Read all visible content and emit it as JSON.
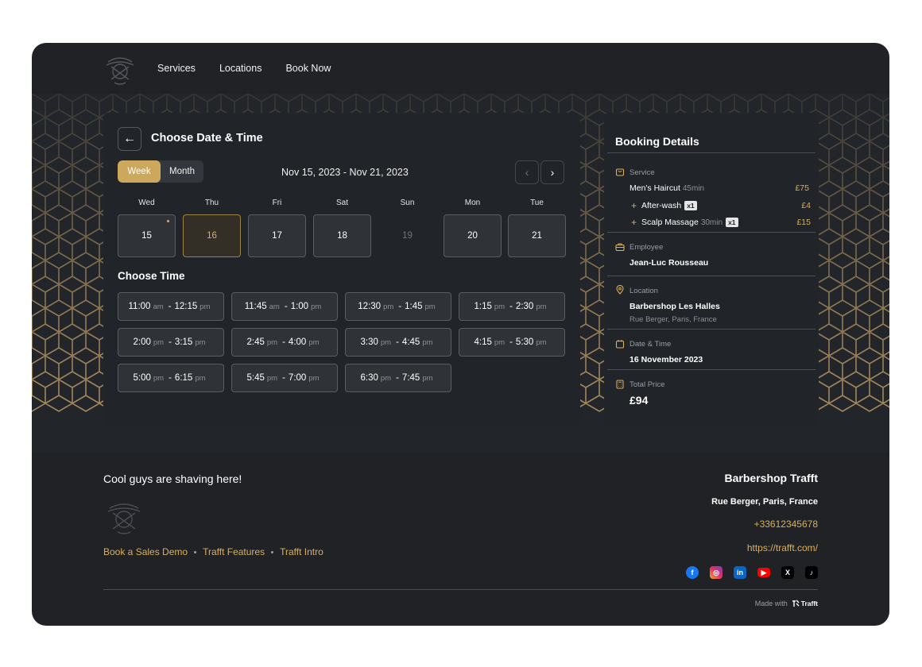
{
  "nav": {
    "items": [
      "Services",
      "Locations",
      "Book Now"
    ]
  },
  "calendar": {
    "title": "Choose Date & Time",
    "view_week": "Week",
    "view_month": "Month",
    "range": "Nov 15, 2023 - Nov 21, 2023",
    "days": [
      {
        "name": "Wed",
        "num": "15",
        "state": "available",
        "dot": true
      },
      {
        "name": "Thu",
        "num": "16",
        "state": "selected",
        "dot": false
      },
      {
        "name": "Fri",
        "num": "17",
        "state": "available",
        "dot": false
      },
      {
        "name": "Sat",
        "num": "18",
        "state": "available",
        "dot": false
      },
      {
        "name": "Sun",
        "num": "19",
        "state": "unavailable",
        "dot": false
      },
      {
        "name": "Mon",
        "num": "20",
        "state": "available",
        "dot": false
      },
      {
        "name": "Tue",
        "num": "21",
        "state": "available",
        "dot": false
      }
    ],
    "choose_time": "Choose Time",
    "slots": [
      {
        "start": "11:00",
        "start_ap": "am",
        "end": "12:15",
        "end_ap": "pm"
      },
      {
        "start": "11:45",
        "start_ap": "am",
        "end": "1:00",
        "end_ap": "pm"
      },
      {
        "start": "12:30",
        "start_ap": "pm",
        "end": "1:45",
        "end_ap": "pm"
      },
      {
        "start": "1:15",
        "start_ap": "pm",
        "end": "2:30",
        "end_ap": "pm"
      },
      {
        "start": "2:00",
        "start_ap": "pm",
        "end": "3:15",
        "end_ap": "pm"
      },
      {
        "start": "2:45",
        "start_ap": "pm",
        "end": "4:00",
        "end_ap": "pm"
      },
      {
        "start": "3:30",
        "start_ap": "pm",
        "end": "4:45",
        "end_ap": "pm"
      },
      {
        "start": "4:15",
        "start_ap": "pm",
        "end": "5:30",
        "end_ap": "pm"
      },
      {
        "start": "5:00",
        "start_ap": "pm",
        "end": "6:15",
        "end_ap": "pm"
      },
      {
        "start": "5:45",
        "start_ap": "pm",
        "end": "7:00",
        "end_ap": "pm"
      },
      {
        "start": "6:30",
        "start_ap": "pm",
        "end": "7:45",
        "end_ap": "pm"
      }
    ]
  },
  "booking": {
    "title": "Booking Details",
    "service_label": "Service",
    "service": {
      "name": "Men's Haircut",
      "duration": "45min",
      "price": "£75"
    },
    "extras": [
      {
        "name": "After-wash",
        "duration": "",
        "qty": "x1",
        "price": "£4"
      },
      {
        "name": "Scalp Massage",
        "duration": "30min",
        "qty": "x1",
        "price": "£15"
      }
    ],
    "employee_label": "Employee",
    "employee": "Jean-Luc Rousseau",
    "location_label": "Location",
    "location_name": "Barbershop Les Halles",
    "location_address": "Rue Berger, Paris, France",
    "datetime_label": "Date & Time",
    "datetime": "16 November 2023",
    "total_label": "Total Price",
    "total": "£94"
  },
  "footer": {
    "tagline": "Cool guys are shaving here!",
    "links": [
      "Book a Sales Demo",
      "Trafft Features",
      "Trafft Intro"
    ],
    "brand": "Barbershop Trafft",
    "address": "Rue Berger, Paris, France",
    "phone": "+33612345678",
    "url": "https://trafft.com/",
    "socials": [
      "facebook-icon",
      "instagram-icon",
      "linkedin-icon",
      "youtube-icon",
      "x-icon",
      "tiktok-icon"
    ],
    "made_with": "Made with",
    "made_brand": "Trafft"
  },
  "colors": {
    "accent": "#cca85d",
    "gold_text": "#d9b05c",
    "background": "#202226"
  }
}
